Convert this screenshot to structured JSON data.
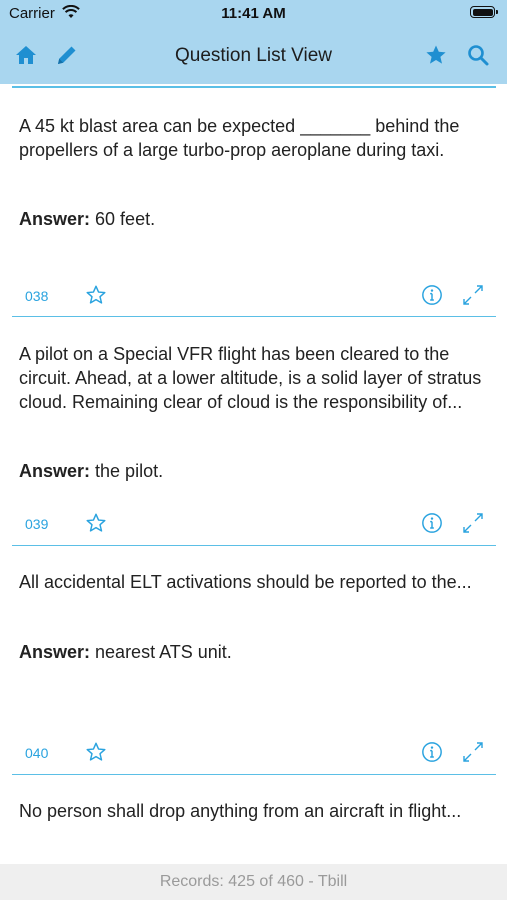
{
  "status_bar": {
    "carrier": "Carrier",
    "time": "11:41 AM"
  },
  "nav": {
    "title": "Question List View",
    "left_icons": [
      "home-icon",
      "pencil-icon"
    ],
    "right_icons": [
      "star-icon",
      "search-icon"
    ]
  },
  "colors": {
    "accent": "#2aa3df",
    "header_bg": "#a9d6ef",
    "divider": "#5bbfe6",
    "footer_bg": "#efefef"
  },
  "questions": [
    {
      "number": "038",
      "question": "A 45 kt blast area can be expected _______ behind the propellers of a large turbo-prop aeroplane during taxi.",
      "answer_label": "Answer:",
      "answer": "60 feet."
    },
    {
      "number": "039",
      "question": "A pilot on a Special VFR flight has been cleared to the circuit. Ahead, at a lower altitude, is a solid layer of stratus cloud. Remaining clear of cloud is the responsibility of...",
      "answer_label": "Answer:",
      "answer": "the pilot."
    },
    {
      "number": "040",
      "question": "All accidental ELT activations should be reported to the...",
      "answer_label": "Answer:",
      "answer": "nearest ATS unit."
    },
    {
      "number": "",
      "question": "No person shall drop anything from an aircraft in flight...",
      "answer_label": "",
      "answer": ""
    }
  ],
  "footer": {
    "records": "Records: 425 of 460 - Tbill"
  }
}
